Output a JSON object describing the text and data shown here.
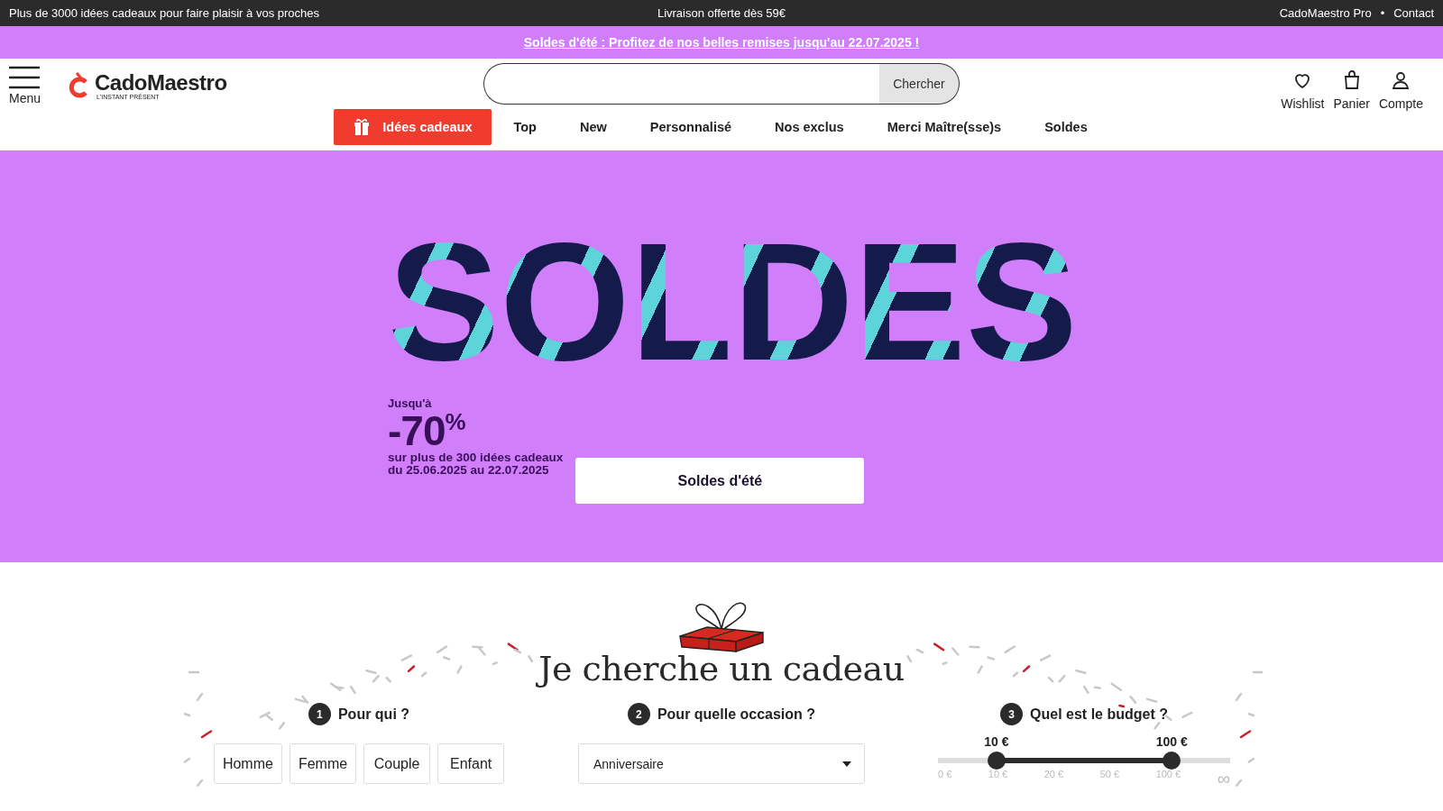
{
  "top_bar": {
    "left": "Plus de 3000 idées cadeaux pour faire plaisir à vos proches",
    "center": "Livraison offerte dès 59€",
    "links": [
      "CadoMaestro Pro",
      "Contact"
    ],
    "separator": "•"
  },
  "promo_banner": {
    "text": "Soldes d'été : Profitez de nos belles remises jusqu'au 22.07.2025 !"
  },
  "header": {
    "menu_label": "Menu",
    "logo": {
      "name": "CadoMaestro",
      "tagline": "L'INSTANT PRÉSENT"
    },
    "search": {
      "button": "Chercher"
    },
    "actions": [
      {
        "kind": "heart",
        "label": "Wishlist"
      },
      {
        "kind": "bag",
        "label": "Panier"
      },
      {
        "kind": "user",
        "label": "Compte"
      }
    ]
  },
  "nav": [
    {
      "label": "Idées cadeaux",
      "highlighted": true
    },
    {
      "label": "Top",
      "highlighted": false
    },
    {
      "label": "New",
      "highlighted": false
    },
    {
      "label": "Personnalisé",
      "highlighted": false
    },
    {
      "label": "Nos exclus",
      "highlighted": false
    },
    {
      "label": "Merci Maître(sse)s",
      "highlighted": false
    },
    {
      "label": "Soldes",
      "highlighted": false
    }
  ],
  "hero": {
    "headline": "SOLDES",
    "prefix": "Jusqu'à",
    "discount": "-70",
    "percent": "%",
    "details": [
      "sur plus de 300 idées cadeaux",
      "du 25.06.2025 au 22.07.2025"
    ],
    "button": "Soldes d'été"
  },
  "gift_finder": {
    "title": "Je cherche un cadeau",
    "steps": [
      {
        "number": "1",
        "label": "Pour qui ?"
      },
      {
        "number": "2",
        "label": "Pour quelle occasion ?"
      },
      {
        "number": "3",
        "label": "Quel est le budget ?"
      }
    ],
    "recipients": [
      "Homme",
      "Femme",
      "Couple",
      "Enfant"
    ],
    "occasion": "Anniversaire",
    "budget": {
      "low_label": "10 €",
      "high_label": "100 €",
      "low": {
        "level": 0.2
      },
      "high": {
        "level": 0.8
      },
      "ticks": [
        "0 €",
        "10 €",
        "20 €",
        "50 €",
        "100 €",
        "∞"
      ]
    }
  }
}
